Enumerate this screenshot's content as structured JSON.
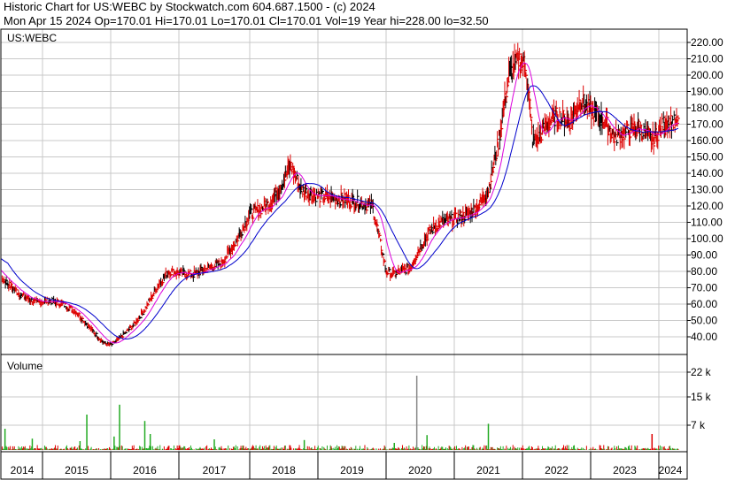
{
  "header": {
    "line1": "Historic Chart for US:WEBC by Stockwatch.com 604.687.1500 - (c) 2024",
    "line2": "Mon Apr 15 2024   Op=170.01  Hi=170.01  Lo=170.01  Cl=170.01  Vol=19   Year hi=228.00   lo=32.50"
  },
  "panels": {
    "price_label": "US:WEBC",
    "volume_label": "Volume"
  },
  "colors": {
    "grid": "#c8c8c8",
    "bars_up": "#000000",
    "bars_down": "#dd0000",
    "ma_short": "#dd00dd",
    "ma_long": "#0000cc",
    "vol_up": "#22aa22",
    "vol_down": "#dd0000"
  },
  "chart_data": [
    {
      "type": "line",
      "title": "US:WEBC",
      "ylim": [
        30,
        230
      ],
      "y_ticks": [
        "40.00",
        "50.00",
        "60.00",
        "70.00",
        "80.00",
        "90.00",
        "100.00",
        "110.00",
        "120.00",
        "130.00",
        "140.00",
        "150.00",
        "160.00",
        "170.00",
        "180.00",
        "190.00",
        "200.00",
        "210.00",
        "220.00"
      ],
      "x_ticks": [
        "2014",
        "2015",
        "2016",
        "2017",
        "2018",
        "2019",
        "2020",
        "2021",
        "2022",
        "2023",
        "2024"
      ],
      "x_range": [
        2014.0,
        2024.3
      ],
      "series": [
        {
          "x": [
            2014.0,
            2014.1,
            2014.2,
            2014.35,
            2014.5,
            2014.7,
            2014.9,
            2015.1,
            2015.3,
            2015.5,
            2015.7,
            2015.9,
            2016.0,
            2016.1,
            2016.2,
            2016.35,
            2016.5,
            2016.7,
            2016.85,
            2017.0,
            2017.2,
            2017.4,
            2017.6,
            2017.8,
            2018.0,
            2018.15,
            2018.3,
            2018.45,
            2018.6,
            2018.75,
            2018.85,
            2019.0,
            2019.2,
            2019.4,
            2019.6,
            2019.8,
            2020.0,
            2020.1,
            2020.2,
            2020.35,
            2020.5,
            2020.65,
            2020.8,
            2021.0,
            2021.2,
            2021.35,
            2021.5,
            2021.65,
            2021.8,
            2021.95,
            2022.05,
            2022.15,
            2022.25,
            2022.35,
            2022.5,
            2022.7,
            2022.85,
            2023.0,
            2023.2,
            2023.35,
            2023.5,
            2023.7,
            2023.9,
            2024.1,
            2024.29
          ],
          "y": [
            105,
            95,
            85,
            78,
            72,
            65,
            61,
            62,
            60,
            55,
            45,
            36,
            35,
            38,
            42,
            48,
            57,
            72,
            80,
            79,
            78,
            82,
            85,
            98,
            115,
            118,
            122,
            132,
            145,
            130,
            128,
            126,
            125,
            124,
            122,
            120,
            80,
            78,
            80,
            82,
            95,
            105,
            110,
            112,
            115,
            120,
            130,
            160,
            200,
            210,
            205,
            160,
            162,
            170,
            175,
            172,
            185,
            178,
            172,
            162,
            165,
            168,
            160,
            172,
            170
          ]
        }
      ]
    },
    {
      "type": "bar",
      "title": "Volume",
      "y_ticks": [
        "7 k",
        "15 k",
        "22 k"
      ],
      "ylim": [
        0,
        26000
      ],
      "notable_volumes": [
        {
          "x": 2014.45,
          "v": 6000
        },
        {
          "x": 2014.85,
          "v": 3200
        },
        {
          "x": 2015.55,
          "v": 2500
        },
        {
          "x": 2015.65,
          "v": 10000
        },
        {
          "x": 2016.05,
          "v": 3800
        },
        {
          "x": 2016.13,
          "v": 12800
        },
        {
          "x": 2016.5,
          "v": 8200
        },
        {
          "x": 2016.58,
          "v": 4500
        },
        {
          "x": 2017.5,
          "v": 3000
        },
        {
          "x": 2018.8,
          "v": 2800
        },
        {
          "x": 2020.12,
          "v": 2000
        },
        {
          "x": 2020.45,
          "v": 21000
        },
        {
          "x": 2020.6,
          "v": 4200
        },
        {
          "x": 2021.5,
          "v": 7400
        },
        {
          "x": 2023.9,
          "v": 4500
        }
      ]
    }
  ]
}
